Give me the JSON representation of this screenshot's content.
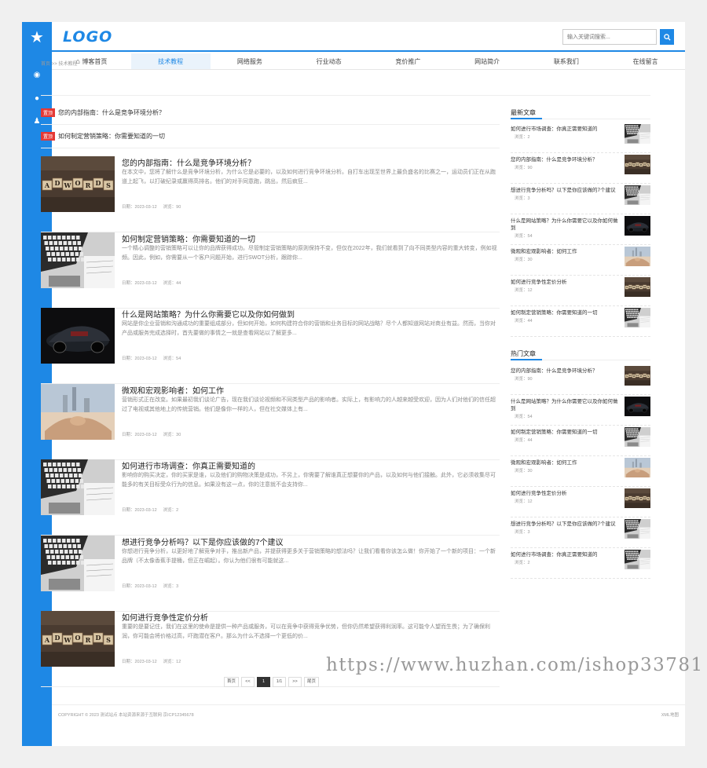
{
  "header": {
    "logo": "LOGO",
    "search_placeholder": "输入关键词搜索..."
  },
  "nav": [
    "博客首页",
    "技术教程",
    "网络服务",
    "行业动态",
    "竞价推广",
    "网站简介",
    "联系我们",
    "在线留言"
  ],
  "breadcrumb": "首页 >> 技术教程",
  "notices": [
    {
      "tag": "置顶",
      "text": "您的内部指南：什么是竞争环境分析？"
    },
    {
      "tag": "置顶",
      "text": "如何制定营销策略：你需要知道的一切"
    }
  ],
  "articles": [
    {
      "title": "您的内部指南：什么是竞争环境分析？",
      "desc": "在本文中，您将了解什么是竞争环境分析，为什么它是必要的，以及如何进行竞争环境分析。自打车出现至世界上最负盛名的比赛之一，运动员们正在从跑道上起飞，以打破纪录或赢得高排名。他们的对手同意跑，跳出，然后疯狂...",
      "date": "日期：2023-03-12",
      "views": "浏览：90",
      "thumb": "adwords"
    },
    {
      "title": "如何制定营销策略：你需要知道的一切",
      "desc": "一个精心调整的营销策略可以让你的品牌获得成功。尽管制定营销策略的原则保持不变，但仅在2022年，我们就看到了向不同类型内容的重大转变，例如视频。因此，例如，你需要从一个客户问题开始，进行SWOT分析，跟踪你...",
      "date": "日期：2023-03-12",
      "views": "浏览：44",
      "thumb": "laptop"
    },
    {
      "title": "什么是网站策略？为什么你需要它以及你如何做到",
      "desc": "网站是你企业营销和沟通成功的重要组成部分，但如何开始，如何构建符合你的营销和业务目标的网站战略？尽个人都知道网站对商业有益。然而，当你对产品或服务完成选择时，首先要做的事情之一就是查看网站以了解更多...",
      "date": "日期：2023-03-12",
      "views": "浏览：54",
      "thumb": "car"
    },
    {
      "title": "微观和宏观影响者：如何工作",
      "desc": "营销形式正在改变。如果最初我们谈论广告，现在我们谈论视频和不同类型产品的影响者。实际上，有影响力的人越来越受欢迎，因为人们对他们的信任超过了电视或其他地上的传统营销。他们是像你一样的人，但在社交媒体上有...",
      "date": "日期：2023-03-12",
      "views": "浏览：30",
      "thumb": "handshake"
    },
    {
      "title": "如何进行市场调查：你真正需要知道的",
      "desc": "影响你的购买决定，你的买家是谁，以及他们的购物决策是成功，不另上，你需要了解谁真正想要你的产品，以及如何与他们接触。此外，它必须收集尽可能多的有关目标受众行为的信息。如果没有这一点，你的注意就不会支持你...",
      "date": "日期：2023-03-12",
      "views": "浏览：2",
      "thumb": "laptop"
    },
    {
      "title": "想进行竞争分析吗？以下是你应该做的7个建议",
      "desc": "你想进行竞争分析，以更好地了解竞争对手，推出新产品，并提获得更多关于营销策略的想法吗？让我们看看你该怎么做！你开始了一个新的项目：一个新品牌（不太像香蕉手提桶，但正在崛起）。你认为他们很有可能就这...",
      "date": "日期：2023-03-12",
      "views": "浏览：3",
      "thumb": "laptop"
    },
    {
      "title": "如何进行竞争性定价分析",
      "desc": "重要的是要记住，我们在这里的使命是提供一种产品或服务，可以在竞争中获得竞争优势，但你仍然希望获得利润率。这可能令人望而生畏；为了确保利润，你可能会将价格过高，吓跑潜在客户。那么为什么不选择一个更低的价...",
      "date": "日期：2023-03-12",
      "views": "浏览：12",
      "thumb": "adwords"
    }
  ],
  "sidebar": {
    "latest_title": "最新文章",
    "latest": [
      {
        "title": "如何进行市场调查：你真正需要知道的",
        "views": "浏览：2",
        "thumb": "laptop"
      },
      {
        "title": "您的内部指南：什么是竞争环境分析？",
        "views": "浏览：90",
        "thumb": "adwords"
      },
      {
        "title": "想进行竞争分析吗？以下是你应该做的7个建议",
        "views": "浏览：3",
        "thumb": "laptop"
      },
      {
        "title": "什么是网站策略？为什么你需要它以及你如何做到",
        "views": "浏览：54",
        "thumb": "car"
      },
      {
        "title": "微观和宏观影响者：如何工作",
        "views": "浏览：30",
        "thumb": "handshake"
      },
      {
        "title": "如何进行竞争性定价分析",
        "views": "浏览：12",
        "thumb": "adwords"
      },
      {
        "title": "如何制定营销策略：你需要知道的一切",
        "views": "浏览：44",
        "thumb": "laptop"
      }
    ],
    "hot_title": "热门文章",
    "hot": [
      {
        "title": "您的内部指南：什么是竞争环境分析？",
        "views": "浏览：90",
        "thumb": "adwords"
      },
      {
        "title": "什么是网站策略？为什么你需要它以及你如何做到",
        "views": "浏览：54",
        "thumb": "car"
      },
      {
        "title": "如何制定营销策略：你需要知道的一切",
        "views": "浏览：44",
        "thumb": "laptop"
      },
      {
        "title": "微观和宏观影响者：如何工作",
        "views": "浏览：30",
        "thumb": "handshake"
      },
      {
        "title": "如何进行竞争性定价分析",
        "views": "浏览：12",
        "thumb": "adwords"
      },
      {
        "title": "想进行竞争分析吗？以下是你应该做的7个建议",
        "views": "浏览：3",
        "thumb": "laptop"
      },
      {
        "title": "如何进行市场调查：你真正需要知道的",
        "views": "浏览：2",
        "thumb": "laptop"
      }
    ]
  },
  "pager": [
    "首页",
    "<<",
    "1",
    "1/1",
    ">>",
    "尾页"
  ],
  "footer": {
    "copyright": "COPYRIGHT © 2023 测试站点 本站资源来源于互联网 京ICP12345678",
    "xml": "XML地图"
  },
  "watermark": "https://www.huzhan.com/ishop33781"
}
